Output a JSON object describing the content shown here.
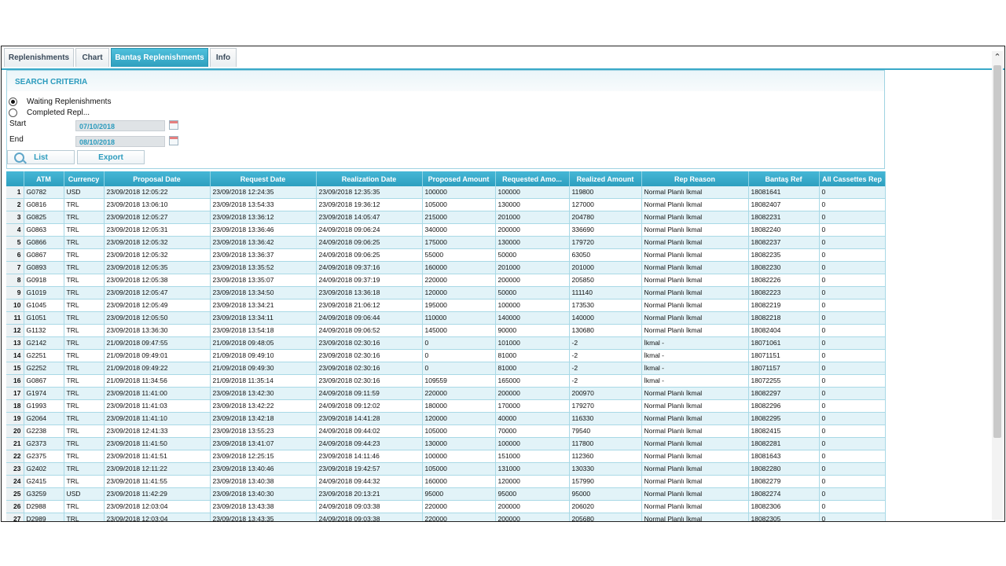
{
  "tabs": [
    "Replenishments",
    "Chart",
    "Bantaş Replenishments",
    "Info"
  ],
  "active_tab": "Bantaş Replenishments",
  "search": {
    "title": "SEARCH CRITERIA",
    "radio_waiting": "Waiting Replenishments",
    "radio_completed": "Completed Repl...",
    "selected": "waiting",
    "start_label": "Start",
    "start_value": "07/10/2018",
    "end_label": "End",
    "end_value": "08/10/2018",
    "list_button": "List",
    "export_button": "Export"
  },
  "table": {
    "columns": [
      "",
      "ATM",
      "Currency",
      "Proposal Date",
      "Request Date",
      "Realization Date",
      "Proposed Amount",
      "Requested Amo...",
      "Realized Amount",
      "Rep Reason",
      "Bantaş Ref",
      "All Cassettes Rep"
    ],
    "rows": [
      [
        "1",
        "G0782",
        "USD",
        "23/09/2018 12:05:22",
        "23/09/2018 12:24:35",
        "23/09/2018 12:35:35",
        "100000",
        "100000",
        "119800",
        "Normal Planlı İkmal",
        "18081641",
        "0"
      ],
      [
        "2",
        "G0816",
        "TRL",
        "23/09/2018 13:06:10",
        "23/09/2018 13:54:33",
        "23/09/2018 19:36:12",
        "105000",
        "130000",
        "127000",
        "Normal Planlı İkmal",
        "18082407",
        "0"
      ],
      [
        "3",
        "G0825",
        "TRL",
        "23/09/2018 12:05:27",
        "23/09/2018 13:36:12",
        "23/09/2018 14:05:47",
        "215000",
        "201000",
        "204780",
        "Normal Planlı İkmal",
        "18082231",
        "0"
      ],
      [
        "4",
        "G0863",
        "TRL",
        "23/09/2018 12:05:31",
        "23/09/2018 13:36:46",
        "24/09/2018 09:06:24",
        "340000",
        "200000",
        "336690",
        "Normal Planlı İkmal",
        "18082240",
        "0"
      ],
      [
        "5",
        "G0866",
        "TRL",
        "23/09/2018 12:05:32",
        "23/09/2018 13:36:42",
        "24/09/2018 09:06:25",
        "175000",
        "130000",
        "179720",
        "Normal Planlı İkmal",
        "18082237",
        "0"
      ],
      [
        "6",
        "G0867",
        "TRL",
        "23/09/2018 12:05:32",
        "23/09/2018 13:36:37",
        "24/09/2018 09:06:25",
        "55000",
        "50000",
        "63050",
        "Normal Planlı İkmal",
        "18082235",
        "0"
      ],
      [
        "7",
        "G0893",
        "TRL",
        "23/09/2018 12:05:35",
        "23/09/2018 13:35:52",
        "24/09/2018 09:37:16",
        "160000",
        "201000",
        "201000",
        "Normal Planlı İkmal",
        "18082230",
        "0"
      ],
      [
        "8",
        "G0918",
        "TRL",
        "23/09/2018 12:05:38",
        "23/09/2018 13:35:07",
        "24/09/2018 09:37:19",
        "220000",
        "200000",
        "205850",
        "Normal Planlı İkmal",
        "18082226",
        "0"
      ],
      [
        "9",
        "G1019",
        "TRL",
        "23/09/2018 12:05:47",
        "23/09/2018 13:34:50",
        "23/09/2018 13:36:18",
        "120000",
        "50000",
        "111140",
        "Normal Planlı İkmal",
        "18082223",
        "0"
      ],
      [
        "10",
        "G1045",
        "TRL",
        "23/09/2018 12:05:49",
        "23/09/2018 13:34:21",
        "23/09/2018 21:06:12",
        "195000",
        "100000",
        "173530",
        "Normal Planlı İkmal",
        "18082219",
        "0"
      ],
      [
        "11",
        "G1051",
        "TRL",
        "23/09/2018 12:05:50",
        "23/09/2018 13:34:11",
        "24/09/2018 09:06:44",
        "110000",
        "140000",
        "140000",
        "Normal Planlı İkmal",
        "18082218",
        "0"
      ],
      [
        "12",
        "G1132",
        "TRL",
        "23/09/2018 13:36:30",
        "23/09/2018 13:54:18",
        "24/09/2018 09:06:52",
        "145000",
        "90000",
        "130680",
        "Normal Planlı İkmal",
        "18082404",
        "0"
      ],
      [
        "13",
        "G2142",
        "TRL",
        "21/09/2018 09:47:55",
        "21/09/2018 09:48:05",
        "23/09/2018 02:30:16",
        "0",
        "101000",
        "-2",
        "İkmal -",
        "18071061",
        "0"
      ],
      [
        "14",
        "G2251",
        "TRL",
        "21/09/2018 09:49:01",
        "21/09/2018 09:49:10",
        "23/09/2018 02:30:16",
        "0",
        "81000",
        "-2",
        "İkmal -",
        "18071151",
        "0"
      ],
      [
        "15",
        "G2252",
        "TRL",
        "21/09/2018 09:49:22",
        "21/09/2018 09:49:30",
        "23/09/2018 02:30:16",
        "0",
        "81000",
        "-2",
        "İkmal -",
        "18071157",
        "0"
      ],
      [
        "16",
        "G0867",
        "TRL",
        "21/09/2018 11:34:56",
        "21/09/2018 11:35:14",
        "23/09/2018 02:30:16",
        "109559",
        "165000",
        "-2",
        "İkmal -",
        "18072255",
        "0"
      ],
      [
        "17",
        "G1974",
        "TRL",
        "23/09/2018 11:41:00",
        "23/09/2018 13:42:30",
        "24/09/2018 09:11:59",
        "220000",
        "200000",
        "200970",
        "Normal Planlı İkmal",
        "18082297",
        "0"
      ],
      [
        "18",
        "G1993",
        "TRL",
        "23/09/2018 11:41:03",
        "23/09/2018 13:42:22",
        "24/09/2018 09:12:02",
        "180000",
        "170000",
        "179270",
        "Normal Planlı İkmal",
        "18082296",
        "0"
      ],
      [
        "19",
        "G2064",
        "TRL",
        "23/09/2018 11:41:10",
        "23/09/2018 13:42:18",
        "23/09/2018 14:41:28",
        "120000",
        "40000",
        "116330",
        "Normal Planlı İkmal",
        "18082295",
        "0"
      ],
      [
        "20",
        "G2238",
        "TRL",
        "23/09/2018 12:41:33",
        "23/09/2018 13:55:23",
        "24/09/2018 09:44:02",
        "105000",
        "70000",
        "79540",
        "Normal Planlı İkmal",
        "18082415",
        "0"
      ],
      [
        "21",
        "G2373",
        "TRL",
        "23/09/2018 11:41:50",
        "23/09/2018 13:41:07",
        "24/09/2018 09:44:23",
        "130000",
        "100000",
        "117800",
        "Normal Planlı İkmal",
        "18082281",
        "0"
      ],
      [
        "22",
        "G2375",
        "TRL",
        "23/09/2018 11:41:51",
        "23/09/2018 12:25:15",
        "23/09/2018 14:11:46",
        "100000",
        "151000",
        "112360",
        "Normal Planlı İkmal",
        "18081643",
        "0"
      ],
      [
        "23",
        "G2402",
        "TRL",
        "23/09/2018 12:11:22",
        "23/09/2018 13:40:46",
        "23/09/2018 19:42:57",
        "105000",
        "131000",
        "130330",
        "Normal Planlı İkmal",
        "18082280",
        "0"
      ],
      [
        "24",
        "G2415",
        "TRL",
        "23/09/2018 11:41:55",
        "23/09/2018 13:40:38",
        "24/09/2018 09:44:32",
        "160000",
        "120000",
        "157990",
        "Normal Planlı İkmal",
        "18082279",
        "0"
      ],
      [
        "25",
        "G3259",
        "USD",
        "23/09/2018 11:42:29",
        "23/09/2018 13:40:30",
        "23/09/2018 20:13:21",
        "95000",
        "95000",
        "95000",
        "Normal Planlı İkmal",
        "18082274",
        "0"
      ],
      [
        "26",
        "D2988",
        "TRL",
        "23/09/2018 12:03:04",
        "23/09/2018 13:43:38",
        "24/09/2018 09:03:38",
        "220000",
        "200000",
        "206020",
        "Normal Planlı İkmal",
        "18082306",
        "0"
      ],
      [
        "27",
        "D2989",
        "TRL",
        "23/09/2018 12:03:04",
        "23/09/2018 13:43:35",
        "24/09/2018 09:03:38",
        "220000",
        "200000",
        "205680",
        "Normal Planlı İkmal",
        "18082305",
        "0"
      ]
    ]
  }
}
